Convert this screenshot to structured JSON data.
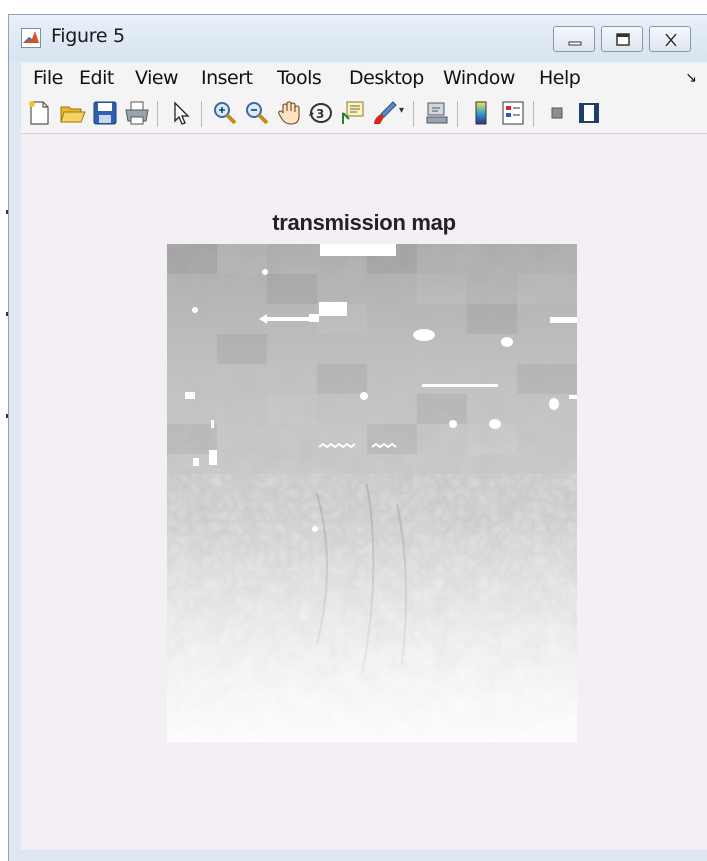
{
  "window": {
    "title": "Figure 5",
    "controls": {
      "minimize": "minimize",
      "maximize": "maximize",
      "close": "close"
    }
  },
  "menubar": {
    "items": [
      "File",
      "Edit",
      "View",
      "Insert",
      "Tools",
      "Desktop",
      "Window",
      "Help"
    ],
    "overflow_icon": "dock-arrow-icon"
  },
  "toolbar": {
    "tools": [
      "new-figure-icon",
      "open-file-icon",
      "save-icon",
      "print-icon",
      "pointer-icon",
      "zoom-in-icon",
      "zoom-out-icon",
      "pan-hand-icon",
      "rotate-3d-icon",
      "data-cursor-icon",
      "brush-icon",
      "link-plot-icon",
      "colorbar-icon",
      "legend-icon",
      "hide-plot-tools-icon",
      "show-plot-tools-icon"
    ]
  },
  "figure": {
    "title": "transmission map",
    "image_kind": "grayscale-image"
  },
  "colors": {
    "window_frame": "#dfe8f2",
    "figure_background": "#f3eff4",
    "toolbar_background": "#f4f4f4"
  }
}
